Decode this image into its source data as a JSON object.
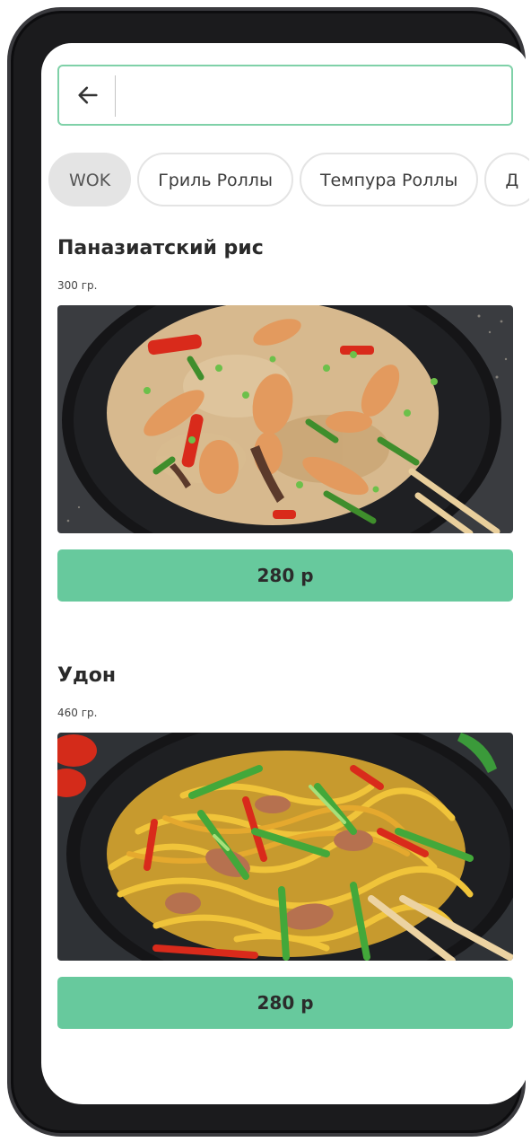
{
  "search": {
    "value": "",
    "placeholder": ""
  },
  "categories": [
    {
      "label": "WOK",
      "active": true
    },
    {
      "label": "Гриль Роллы",
      "active": false
    },
    {
      "label": "Темпура Роллы",
      "active": false
    },
    {
      "label": "Д",
      "active": false
    }
  ],
  "products": [
    {
      "title": "Паназиатский рис",
      "weight": "300 гр.",
      "price": "280 р",
      "photo": "fried-rice-with-chicken-and-vegetables"
    },
    {
      "title": "Удон",
      "weight": "460 гр.",
      "price": "280 р",
      "photo": "udon-noodles-with-vegetables"
    }
  ],
  "colors": {
    "accent": "#67c99d",
    "search_border": "#7fd1a8",
    "chip_active_bg": "#e4e4e4",
    "frame": "#1b1b1d"
  },
  "icons": {
    "back": "arrow-left-icon"
  }
}
